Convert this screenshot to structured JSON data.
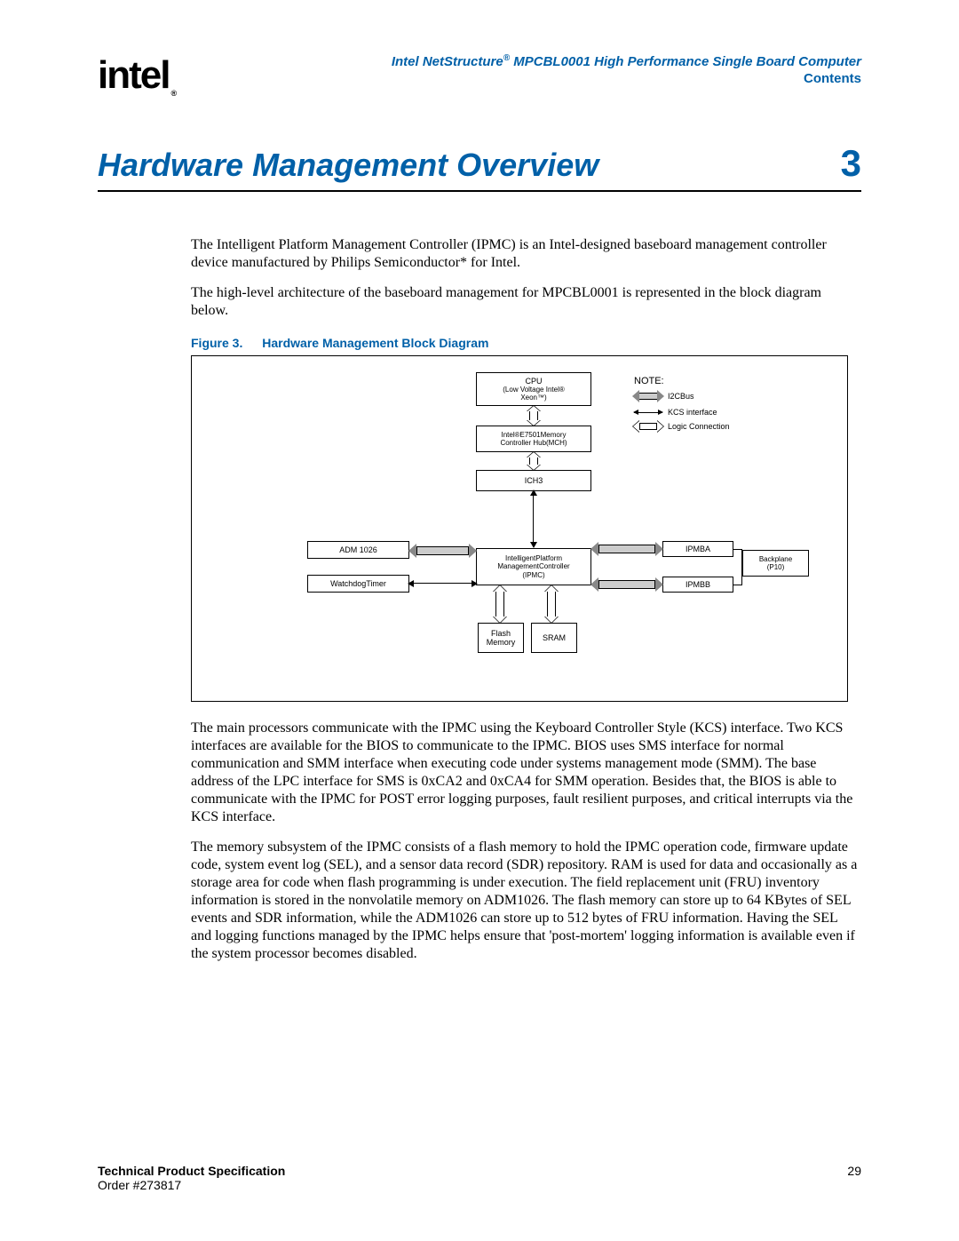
{
  "header": {
    "logo_text": "intel",
    "doc_title_pre": "Intel NetStructure",
    "doc_title_post": " MPCBL0001 High Performance Single Board Computer",
    "contents_link": "Contents"
  },
  "chapter": {
    "title": "Hardware Management Overview",
    "number": "3"
  },
  "paragraphs": {
    "p1": "The Intelligent Platform Management Controller (IPMC) is an Intel-designed baseboard management controller device manufactured by Philips Semiconductor* for Intel.",
    "p2": "The high-level architecture of the baseboard management for MPCBL0001 is represented in the block diagram below.",
    "p3": "The main processors communicate with the IPMC using the Keyboard Controller Style (KCS) interface. Two KCS interfaces are available for the BIOS to communicate to the IPMC. BIOS uses SMS interface for normal communication and SMM interface when executing code under systems management mode (SMM). The base address of the LPC interface for SMS is 0xCA2 and 0xCA4 for SMM operation. Besides that, the BIOS is able to communicate with the IPMC for POST error logging purposes, fault resilient purposes, and critical interrupts via the KCS interface.",
    "p4": "The memory subsystem of the IPMC consists of a flash memory to hold the IPMC operation code, firmware update code, system event log (SEL), and a sensor data record (SDR) repository. RAM is used for data and occasionally as a storage area for code when flash programming is under execution. The field replacement unit (FRU) inventory information is stored in the nonvolatile memory on ADM1026. The flash memory can store up to 64 KBytes of SEL events and SDR information, while the ADM1026 can store up to 512 bytes of FRU information. Having the SEL and logging functions managed by the IPMC helps ensure that 'post-mortem' logging information is available even if the system processor becomes disabled."
  },
  "figure": {
    "label": "Figure 3.",
    "caption": "Hardware Management Block Diagram"
  },
  "diagram": {
    "cpu_l1": "CPU",
    "cpu_l2": "(Low Voltage Intel®",
    "cpu_l3": "Xeon™)",
    "mch_l1": "Intel®E7501Memory",
    "mch_l2": "Controller Hub(MCH)",
    "ich3": "ICH3",
    "adm1026": "ADM 1026",
    "watchdog": "WatchdogTimer",
    "ipmc_l1": "IntelligentPlatform",
    "ipmc_l2": "ManagementController",
    "ipmc_l3": "(IPMC)",
    "ipmba": "IPMBA",
    "ipmbb": "IPMBB",
    "backplane_l1": "Backplane",
    "backplane_l2": "(P10)",
    "flash_l1": "Flash",
    "flash_l2": "Memory",
    "sram": "SRAM",
    "note": "NOTE:",
    "legend_i2c": "I2CBus",
    "legend_kcs": "KCS interface",
    "legend_logic": "Logic Connection"
  },
  "footer": {
    "spec": "Technical Product Specification",
    "order": "Order #273817",
    "page": "29"
  }
}
